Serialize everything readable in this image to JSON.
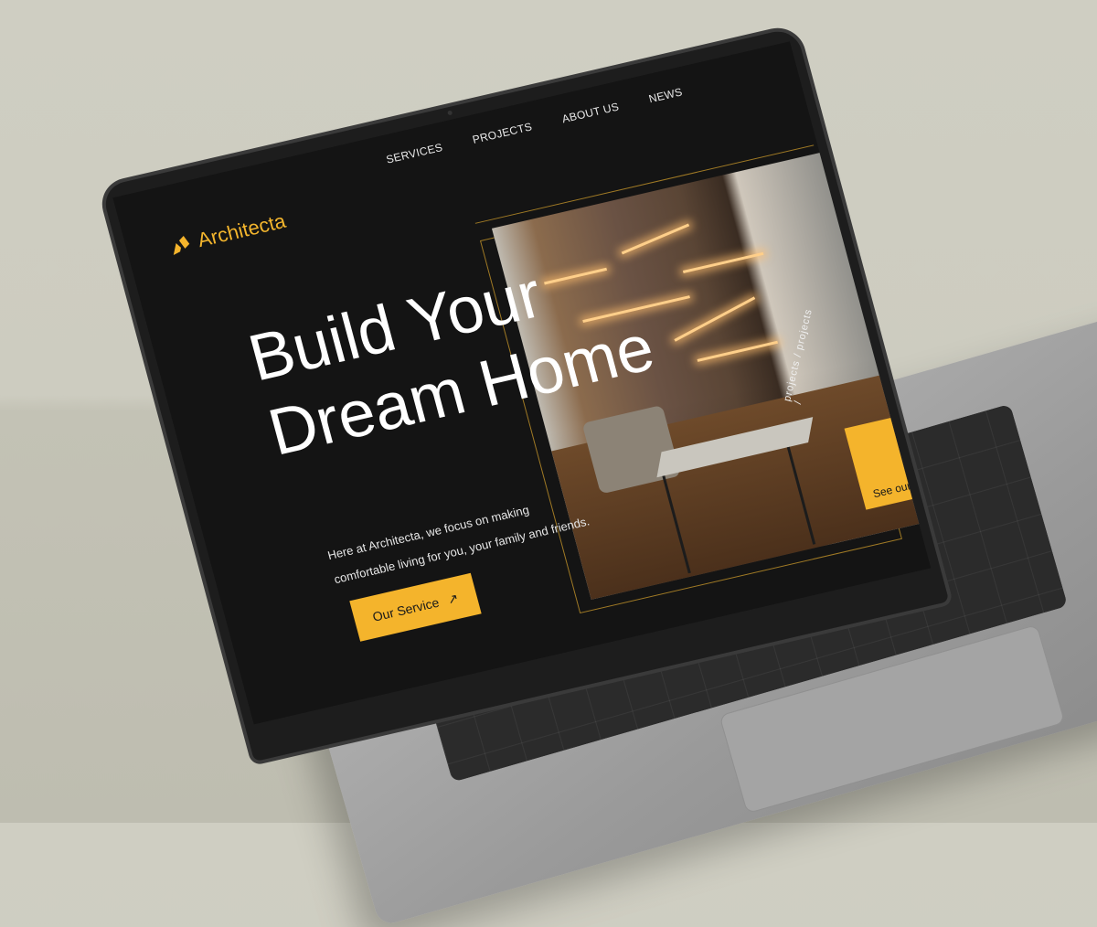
{
  "brand": {
    "name": "Architecta",
    "accent": "#f4b42c"
  },
  "nav": {
    "items": [
      "SERVICES",
      "PROJECTS",
      "ABOUT US",
      "NEWS"
    ]
  },
  "hero": {
    "title_line1": "Build Your",
    "title_line2": "Dream Home",
    "description": "Here at Architecta, we focus on making comfortable living for you, your family and friends.",
    "cta_label": "Our Service",
    "cta_icon": "arrow-up-right-icon"
  },
  "projects_card": {
    "label": "See our recent",
    "rotating_text": "projects / projects /"
  },
  "colors": {
    "background": "#141414",
    "text": "#ffffff",
    "accent": "#f4b42c",
    "line": "#a07a25"
  }
}
